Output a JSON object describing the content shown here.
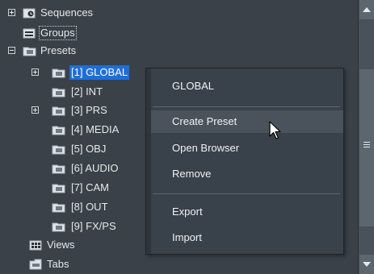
{
  "tree": {
    "items": [
      {
        "label": "Sequences",
        "icon": "sequences-icon",
        "expander": "plus"
      },
      {
        "label": "Groups",
        "icon": "groups-icon",
        "expander": null
      },
      {
        "label": "Presets",
        "icon": "preset-folder-icon",
        "expander": "minus"
      },
      {
        "label": "[1] GLOBAL",
        "icon": "preset-folder-icon",
        "expander": "plus",
        "selected": true
      },
      {
        "label": "[2] INT",
        "icon": "preset-folder-icon",
        "expander": null
      },
      {
        "label": "[3] PRS",
        "icon": "preset-folder-icon",
        "expander": "plus"
      },
      {
        "label": "[4] MEDIA",
        "icon": "preset-folder-icon",
        "expander": null
      },
      {
        "label": "[5] OBJ",
        "icon": "preset-folder-icon",
        "expander": null
      },
      {
        "label": "[6] AUDIO",
        "icon": "preset-folder-icon",
        "expander": null
      },
      {
        "label": "[7] CAM",
        "icon": "preset-folder-icon",
        "expander": null
      },
      {
        "label": "[8] OUT",
        "icon": "preset-folder-icon",
        "expander": null
      },
      {
        "label": "[9] FX/PS",
        "icon": "preset-folder-icon",
        "expander": null
      },
      {
        "label": "Views",
        "icon": "views-icon",
        "expander": null
      },
      {
        "label": "Tabs",
        "icon": "tabs-icon",
        "expander": null
      }
    ]
  },
  "context_menu": {
    "header": "GLOBAL",
    "items": [
      "Create Preset",
      "Open Browser",
      "Remove"
    ],
    "items2": [
      "Export",
      "Import"
    ],
    "hovered": "Create Preset"
  },
  "colors": {
    "background": "#3a4148",
    "selection": "#1f6ed6",
    "menu_background": "#39414a",
    "menu_hover": "#4a535c"
  }
}
